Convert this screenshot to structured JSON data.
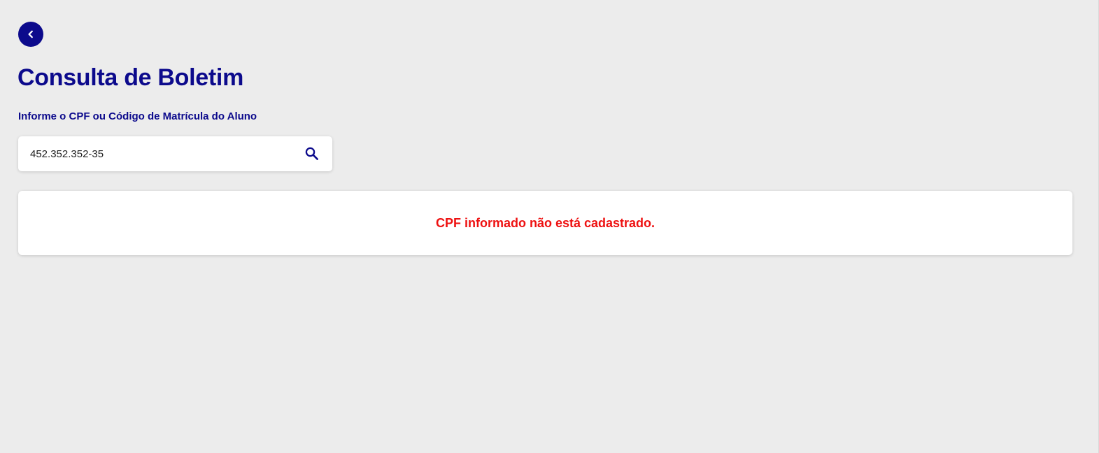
{
  "header": {
    "back_icon": "chevron-left-icon",
    "title": "Consulta de Boletim"
  },
  "search": {
    "label": "Informe o CPF ou Código de Matrícula do Aluno",
    "value": "452.352.352-35",
    "search_icon": "search-icon"
  },
  "result": {
    "message": "CPF informado não está cadastrado."
  },
  "colors": {
    "brand": "#0c0a8c",
    "error": "#ee1111",
    "background": "#ececec",
    "card": "#ffffff"
  }
}
